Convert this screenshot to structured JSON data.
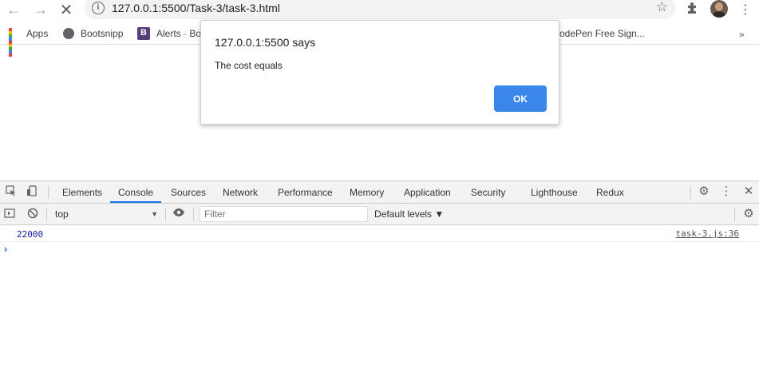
{
  "browser": {
    "url": "127.0.0.1:5500/Task-3/task-3.html"
  },
  "bookmarks": [
    {
      "label": "Apps"
    },
    {
      "label": "Bootsnipp"
    },
    {
      "label": "Alerts · Boo"
    },
    {
      "label": "odePen Free Sign..."
    }
  ],
  "dialog": {
    "title": "127.0.0.1:5500 says",
    "message": "The cost equals",
    "ok_label": "OK"
  },
  "devtools": {
    "tabs": [
      {
        "label": "Elements"
      },
      {
        "label": "Console"
      },
      {
        "label": "Sources"
      },
      {
        "label": "Network"
      },
      {
        "label": "Performance"
      },
      {
        "label": "Memory"
      },
      {
        "label": "Application"
      },
      {
        "label": "Security"
      },
      {
        "label": "Lighthouse"
      },
      {
        "label": "Redux"
      }
    ],
    "active_tab": "Console",
    "console": {
      "context": "top",
      "filter_placeholder": "Filter",
      "levels_label": "Default levels ▼",
      "logs": [
        {
          "value": "22000",
          "source": "task-3.js:36"
        }
      ],
      "prompt": "›"
    }
  },
  "colors": {
    "accent": "#1a73e8",
    "ok_button": "#3a86eb",
    "log_number": "#1a1aa6"
  }
}
